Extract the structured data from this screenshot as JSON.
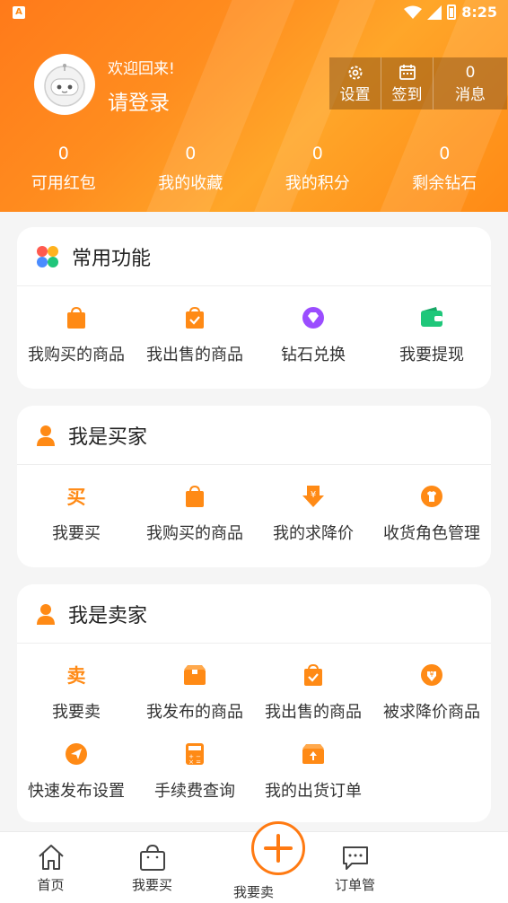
{
  "status_bar": {
    "time": "8:25",
    "app_icon": "A"
  },
  "profile": {
    "welcome": "欢迎回来!",
    "login": "请登录"
  },
  "top_buttons": [
    {
      "icon": "gear-icon",
      "label": "设置"
    },
    {
      "icon": "calendar-icon",
      "label": "签到"
    },
    {
      "count": "0",
      "label": "消息"
    }
  ],
  "stats": [
    {
      "value": "0",
      "label": "可用红包"
    },
    {
      "value": "0",
      "label": "我的收藏"
    },
    {
      "value": "0",
      "label": "我的积分"
    },
    {
      "value": "0",
      "label": "剩余钻石"
    }
  ],
  "common": {
    "title": "常用功能",
    "items": [
      {
        "icon": "shopping-bag-icon",
        "label": "我购买的商品"
      },
      {
        "icon": "sold-check-icon",
        "label": "我出售的商品"
      },
      {
        "icon": "diamond-icon",
        "label": "钻石兑换"
      },
      {
        "icon": "wallet-icon",
        "label": "我要提现"
      }
    ]
  },
  "buyer": {
    "title": "我是买家",
    "buy_char": "买",
    "items": [
      {
        "icon": "buy-char-icon",
        "label": "我要买"
      },
      {
        "icon": "shopping-bag-icon",
        "label": "我购买的商品"
      },
      {
        "icon": "price-down-icon",
        "label": "我的求降价"
      },
      {
        "icon": "shirt-icon",
        "label": "收货角色管理"
      }
    ]
  },
  "seller": {
    "title": "我是卖家",
    "sell_char": "卖",
    "items": [
      {
        "icon": "sell-char-icon",
        "label": "我要卖"
      },
      {
        "icon": "box-icon",
        "label": "我发布的商品"
      },
      {
        "icon": "sold-check-icon",
        "label": "我出售的商品"
      },
      {
        "icon": "yen-down-icon",
        "label": "被求降价商品"
      },
      {
        "icon": "paper-plane-icon",
        "label": "快速发布设置"
      },
      {
        "icon": "calculator-icon",
        "label": "手续费查询"
      },
      {
        "icon": "shipment-icon",
        "label": "我的出货订单"
      }
    ]
  },
  "bottom_nav": [
    {
      "icon": "home-icon",
      "label": "首页"
    },
    {
      "icon": "bag-icon",
      "label": "我要买"
    },
    {
      "icon": "plus-circle-icon",
      "label": "我要卖"
    },
    {
      "icon": "chat-icon",
      "label": "订单管"
    }
  ],
  "colors": {
    "accent": "#ff8a15",
    "header_start": "#ff7a1a",
    "header_end": "#ffa629",
    "purple": "#9b4dff",
    "green": "#1fc77a"
  }
}
